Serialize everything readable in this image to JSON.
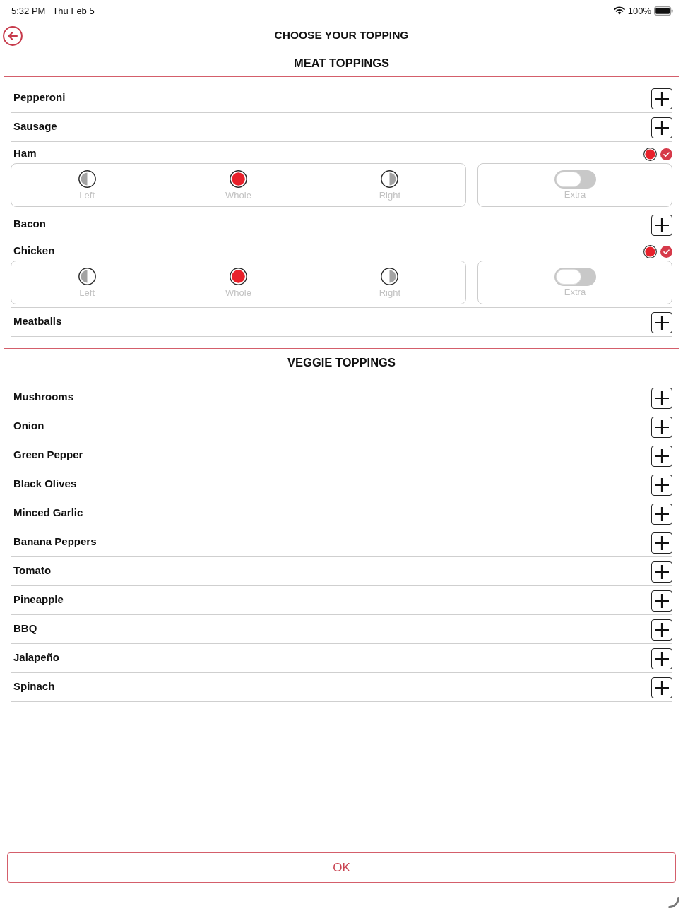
{
  "status_bar": {
    "time": "5:32 PM",
    "date": "Thu Feb 5",
    "battery": "100%"
  },
  "header": {
    "title": "CHOOSE YOUR TOPPING"
  },
  "sections": [
    {
      "title": "MEAT TOPPINGS",
      "items": [
        {
          "name": "Pepperoni",
          "selected": false
        },
        {
          "name": "Sausage",
          "selected": false
        },
        {
          "name": "Ham",
          "selected": true,
          "portions": [
            {
              "kind": "left",
              "label": "Left",
              "selected": false
            },
            {
              "kind": "whole",
              "label": "Whole",
              "selected": true
            },
            {
              "kind": "right",
              "label": "Right",
              "selected": false
            }
          ],
          "extra": {
            "label": "Extra",
            "on": false
          }
        },
        {
          "name": "Bacon",
          "selected": false
        },
        {
          "name": "Chicken",
          "selected": true,
          "portions": [
            {
              "kind": "left",
              "label": "Left",
              "selected": false
            },
            {
              "kind": "whole",
              "label": "Whole",
              "selected": true
            },
            {
              "kind": "right",
              "label": "Right",
              "selected": false
            }
          ],
          "extra": {
            "label": "Extra",
            "on": false
          }
        },
        {
          "name": "Meatballs",
          "selected": false
        }
      ]
    },
    {
      "title": "VEGGIE TOPPINGS",
      "items": [
        {
          "name": "Mushrooms",
          "selected": false
        },
        {
          "name": "Onion",
          "selected": false
        },
        {
          "name": "Green Pepper",
          "selected": false
        },
        {
          "name": "Black Olives",
          "selected": false
        },
        {
          "name": "Minced Garlic",
          "selected": false
        },
        {
          "name": "Banana Peppers",
          "selected": false
        },
        {
          "name": "Tomato",
          "selected": false
        },
        {
          "name": "Pineapple",
          "selected": false
        },
        {
          "name": "BBQ",
          "selected": false
        },
        {
          "name": "Jalapeño",
          "selected": false
        },
        {
          "name": "Spinach",
          "selected": false
        }
      ]
    }
  ],
  "ok_button": {
    "label": "OK"
  }
}
